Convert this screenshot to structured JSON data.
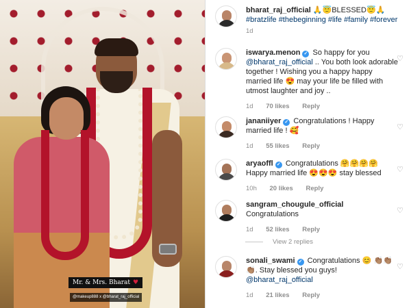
{
  "photo": {
    "caption_tag": "Mr. & Mrs. Bharat",
    "caption_heart": "♥",
    "credit_tag": "@makeup888 x @bharat_raj_official"
  },
  "post": {
    "username": "bharat_raj_official",
    "caption": "🙏😇BLESSED😇🙏",
    "hashtags": "#bratzlife #thebeginning #life #family #forever",
    "time": "1d"
  },
  "comments": [
    {
      "username": "iswarya.menon",
      "verified": true,
      "text": "So happy for you",
      "mention": "@bharat_raj_official",
      "text2": ".. You both look adorable together ! Wishing you a happy happy married life 😍 may your life be filled with utmost laughter and joy ..",
      "time": "1d",
      "likes": "70 likes",
      "reply": "Reply"
    },
    {
      "username": "jananiiyer",
      "verified": true,
      "text": "Congratulations ! Happy married life ! 🥰",
      "time": "1d",
      "likes": "55 likes",
      "reply": "Reply"
    },
    {
      "username": "aryaoffl",
      "verified": true,
      "text": "Congratulations 🤗🤗🤗🤗 Happy married life 😍😍😍 stay blessed",
      "time": "10h",
      "likes": "20 likes",
      "reply": "Reply"
    },
    {
      "username": "sangram_chougule_official",
      "verified": false,
      "text": "Congratulations",
      "time": "1d",
      "likes": "52 likes",
      "reply": "Reply"
    },
    {
      "username": "sonali_swami",
      "verified": true,
      "text": "Congratulations 😊 👏🏽👏🏽👏🏽. Stay blessed you guys!",
      "mention": "@bharat_raj_official",
      "time": "1d",
      "likes": "21 likes",
      "reply": "Reply"
    }
  ],
  "view_replies": "View 2 replies",
  "icons": {
    "verified": "verified-badge-icon",
    "like": "heart-outline-icon"
  },
  "colors": {
    "link": "#00376b",
    "verified": "#3897f0",
    "meta": "#8e8e8e"
  }
}
